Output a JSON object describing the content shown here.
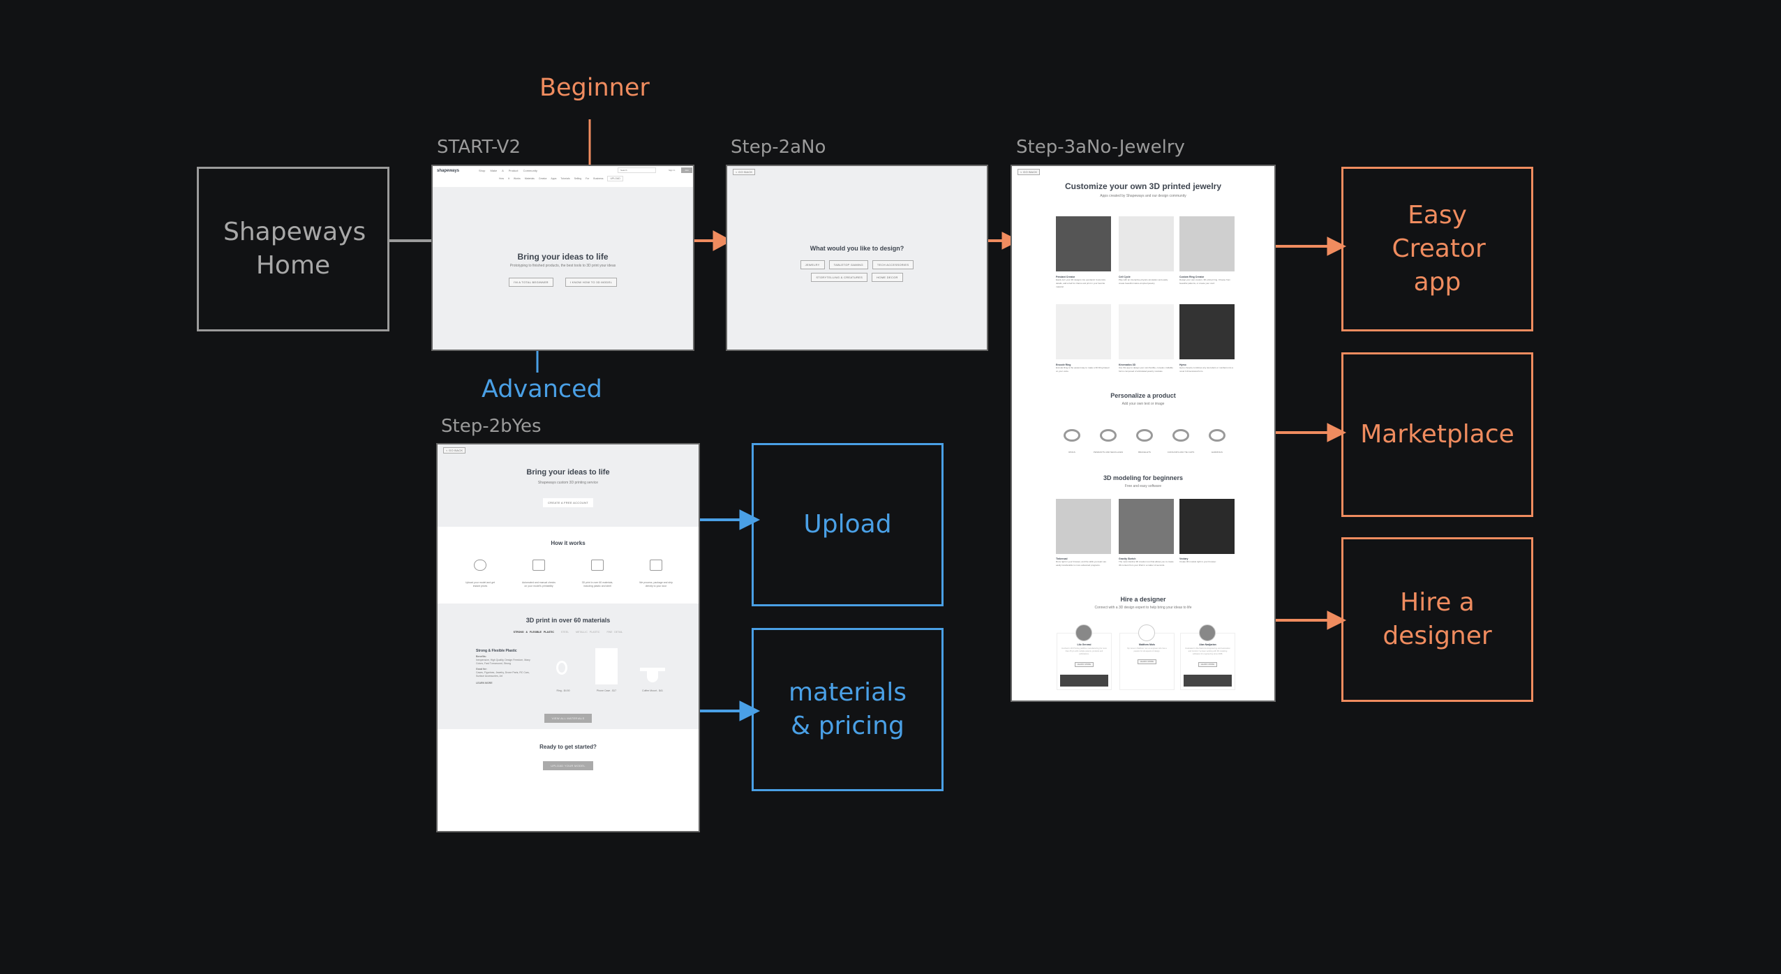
{
  "colors": {
    "background": "#111214",
    "gray": "#9b9b9b",
    "orange": "#f08c5f",
    "blue": "#4aa0e6"
  },
  "nodes": {
    "home": "Shapeways Home",
    "easy_creator": "Easy Creator app",
    "marketplace": "Marketplace",
    "hire_designer": "Hire a designer",
    "upload": "Upload",
    "materials_pricing": "materials & pricing"
  },
  "edge_labels": {
    "beginner": "Beginner",
    "advanced": "Advanced"
  },
  "frames": {
    "start": {
      "label": "START-V2",
      "logo": "shapeways",
      "nav": [
        "Shop",
        "Make A Product",
        "Community"
      ],
      "search": "Search",
      "sign_in": "Sign In",
      "join": "Join",
      "subnav": [
        "How It Works",
        "Materials",
        "Creator Apps",
        "Tutorials",
        "Selling",
        "For Business"
      ],
      "upload": "UPLOAD",
      "title": "Bring your ideas to life",
      "subtitle": "Prototyping to finished products, the best tools to 3D print your ideas",
      "buttons": [
        "I'M A TOTAL BEGINNER",
        "I KNOW HOW TO 3D MODEL"
      ]
    },
    "step2a": {
      "label": "Step-2aNo",
      "back": "< GO BACK",
      "title": "What would you like to design?",
      "row1": [
        "JEWELRY",
        "TABLETOP GAMING",
        "TECH ACCESSORIES"
      ],
      "row2": [
        "STORYTELLING & CREATURES",
        "HOME DECOR"
      ]
    },
    "step3a": {
      "label": "Step-3aNo-Jewelry",
      "back": "< GO BACK",
      "title": "Customize your own 3D printed jewelry",
      "subtitle": "Apps created by Shapeways and our design community",
      "apps": [
        {
          "name": "Pendant Creator",
          "desc": "Easily turn your 2D designs into pendants! Customize details, add a bail for chains and print in your favorite material."
        },
        {
          "name": "Cell Cycle",
          "desc": "Play with an interactive physics simulation and easily create beautiful nature-inspired jewelry."
        },
        {
          "name": "Custom Ring Creator",
          "desc": "Design your own custom, 3D printed ring. Choose from beautiful patterns, or create your own!"
        },
        {
          "name": "Encode Ring",
          "desc": "Encode Ring is the easiest way to make a 3D Ring based on your voice."
        },
        {
          "name": "Kinematics 3D",
          "desc": "Use this app to design your own flexible, complex, foldable forms composed of articulated jewelry modules."
        },
        {
          "name": "Hymo",
          "desc": "Hymo cleverly combines any two letters or numbers into a novel 3 dimensional form."
        }
      ],
      "personalize_title": "Personalize a product",
      "personalize_subtitle": "Add your own text or image",
      "products": [
        "RINGS",
        "PENDANTS AND NECKLACES",
        "BRACELETS",
        "CUFFLINKS AND TIE CLIPS",
        "EARRINGS"
      ],
      "modeling_title": "3D modeling for beginners",
      "modeling_subtitle": "Free and easy software",
      "software": [
        {
          "name": "Tinkercad",
          "desc": "Runs right in your browser, and the skills you learn are easily transferable to more advanced programs."
        },
        {
          "name": "Gravity Sketch",
          "desc": "The most intuitive 3D creation tool that allows you to create 3D content from your iPad in a matter of seconds."
        },
        {
          "name": "Vectary",
          "desc": "Create 3D models right in your browser."
        }
      ],
      "hire_title": "Hire a designer",
      "hire_subtitle": "Connect with a 3D design expert to help bring your ideas to life",
      "designers": [
        {
          "name": "Lilo Gervasi",
          "desc": "Involved in 3D Printing (additive manufacturing) for more than 25 yrs with multiple patents, products and publications."
        },
        {
          "name": "Matthew Mols",
          "desc": "My name is Matthew I am an engineer who has a passion for all aspects of design."
        },
        {
          "name": "Alan Nadjarian",
          "desc": "Graduated in Mechatronics Engineering and Automation and Control. I've been working with 3D modeling softwares for engineering since 2008."
        }
      ],
      "learn_more": "LEARN MORE"
    },
    "step2b": {
      "label": "Step-2bYes",
      "back": "< GO BACK",
      "title": "Bring your ideas to life",
      "subtitle": "Shapeways custom 3D printing service",
      "cta": "CREATE A FREE ACCOUNT",
      "how_title": "How it works",
      "steps": [
        {
          "icon": "cloud-upload-icon",
          "text": "Upload your model and get instant prices"
        },
        {
          "icon": "checklist-icon",
          "text": "Automated and manual checks on your model's printability"
        },
        {
          "icon": "printer-icon",
          "text": "3D print in over 60 materials, including plastic and steel"
        },
        {
          "icon": "truck-icon",
          "text": "We process, package and ship directly to your door"
        }
      ],
      "materials_title": "3D print in over 60 materials",
      "material_tabs": [
        "STRONG & FLEXIBLE PLASTIC",
        "STEEL",
        "METALLIC PLASTIC",
        "FINE DETAIL"
      ],
      "material_name": "Strong & Flexible Plastic",
      "benefits_label": "Benefits:",
      "benefits": "Inexpensive, High Quality, Design Freedom, Many Colors, Fast Turnaround, Strong",
      "good_for_label": "Good for:",
      "good_for": "Cases, Figurines, Jewelry, Drone Parts, RC Cars, Surface Accessories, Art",
      "learn_more": "LEARN MORE",
      "samples": [
        "Ring - $4.50",
        "Phone Case - $17",
        "Coffee Mount - $41"
      ],
      "view_all": "VIEW ALL MATERIALS",
      "ready_title": "Ready to get started?",
      "upload_btn": "UPLOAD YOUR MODEL"
    }
  }
}
